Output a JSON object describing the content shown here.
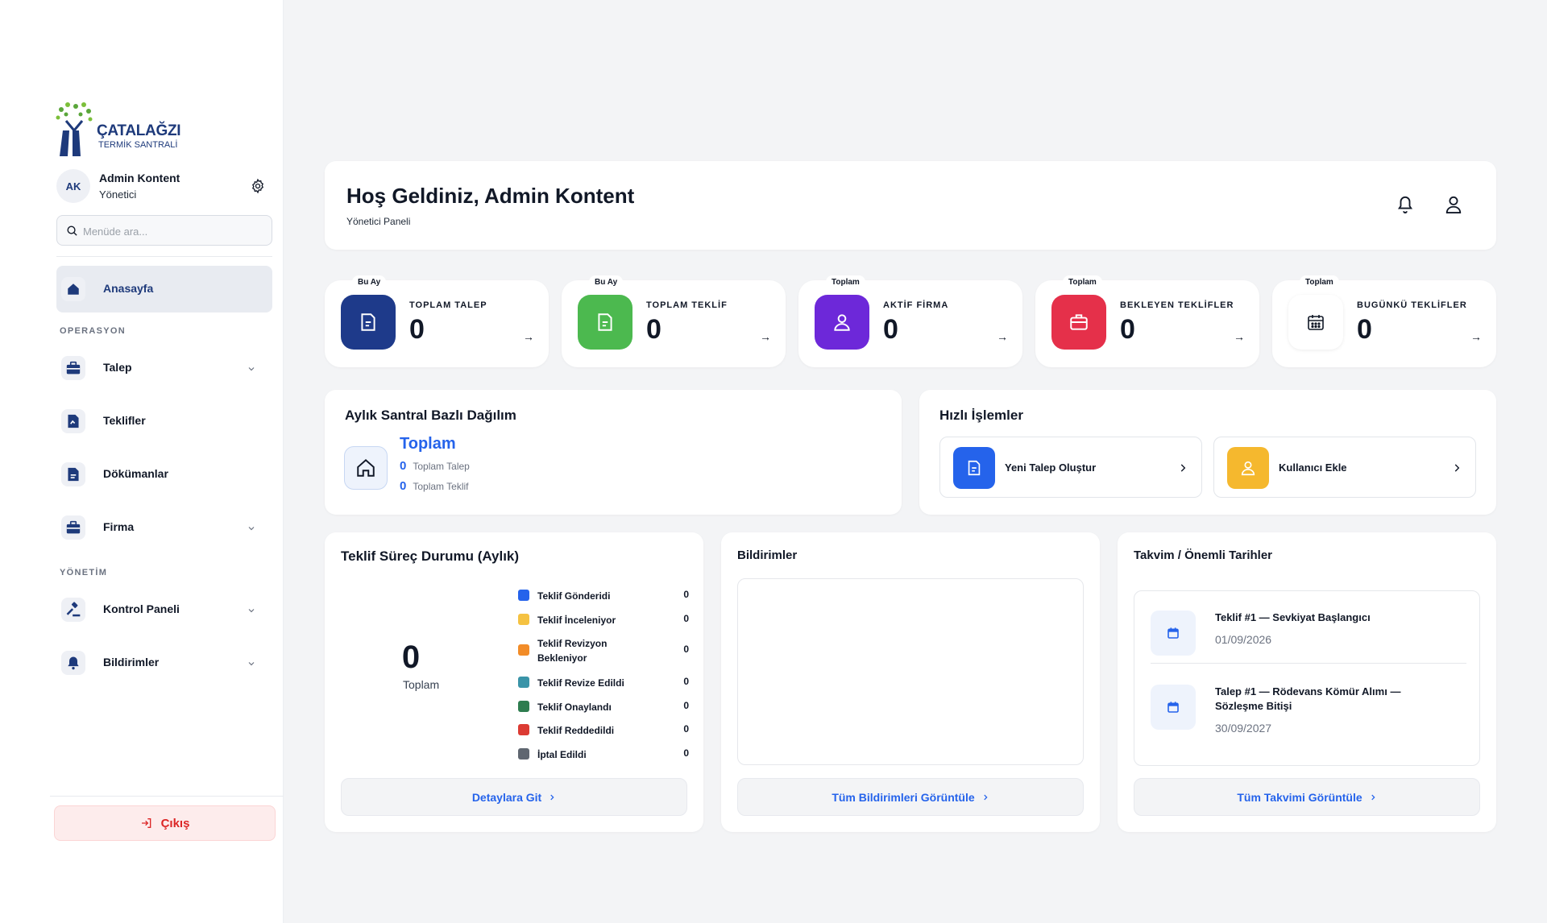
{
  "sidebar": {
    "logo_brand": "ÇATALAĞZI",
    "logo_sub": "TERMİK SANTRALİ",
    "avatar_initials": "AK",
    "user_name": "Admin Kontent",
    "user_role": "Yönetici",
    "search_placeholder": "Menüde ara...",
    "home_label": "Anasayfa",
    "section_ops": "OPERASYON",
    "section_mgmt": "YÖNETİM",
    "items": [
      {
        "label": "Talep",
        "icon": "briefcase-icon",
        "has_chevron": true
      },
      {
        "label": "Teklifler",
        "icon": "document-icon",
        "has_chevron": false
      },
      {
        "label": "Dökümanlar",
        "icon": "document-icon",
        "has_chevron": false
      },
      {
        "label": "Firma",
        "icon": "briefcase-icon",
        "has_chevron": true
      },
      {
        "label": "Kontrol Paneli",
        "icon": "gavel-icon",
        "has_chevron": true
      },
      {
        "label": "Bildirimler",
        "icon": "bell-icon",
        "has_chevron": true
      }
    ],
    "logout_label": "Çıkış"
  },
  "header": {
    "title": "Hoş Geldiniz, Admin Kontent",
    "subtitle": "Yönetici Paneli"
  },
  "stats": [
    {
      "badge": "Bu Ay",
      "title": "TOPLAM TALEP",
      "value": "0",
      "color": "#1e3a8a",
      "icon": "document-icon"
    },
    {
      "badge": "Bu Ay",
      "title": "TOPLAM TEKLİF",
      "value": "0",
      "color": "#4cb94f",
      "icon": "document-icon"
    },
    {
      "badge": "Toplam",
      "title": "AKTİF FİRMA",
      "value": "0",
      "color": "#6d28d9",
      "icon": "user-icon"
    },
    {
      "badge": "Toplam",
      "title": "BEKLEYEN TEKLİFLER",
      "value": "0",
      "color": "#e5304a",
      "icon": "briefcase-icon"
    },
    {
      "badge": "Toplam",
      "title": "BUGÜNKÜ TEKLİFLER",
      "value": "0",
      "color": "#ffffff",
      "icon": "calendar-icon"
    }
  ],
  "distribution": {
    "title": "Aylık Santral Bazlı Dağılım",
    "total_label": "Toplam",
    "talep_value": "0",
    "talep_label": "Toplam Talep",
    "teklif_value": "0",
    "teklif_label": "Toplam Teklif"
  },
  "quick": {
    "title": "Hızlı İşlemler",
    "actions": [
      {
        "label": "Yeni Talep Oluştur",
        "color": "#2563eb"
      },
      {
        "label": "Kullanıcı Ekle",
        "color": "#f5b82e"
      }
    ]
  },
  "process": {
    "title": "Teklif Süreç Durumu (Aylık)",
    "total_value": "0",
    "total_label": "Toplam",
    "legend": [
      {
        "label": "Teklif Gönderidi",
        "value": "0",
        "color": "#2563eb"
      },
      {
        "label": "Teklif İnceleniyor",
        "value": "0",
        "color": "#f5c242"
      },
      {
        "label": "Teklif Revizyon Bekleniyor",
        "value": "0",
        "color": "#f28c28"
      },
      {
        "label": "Teklif Revize Edildi",
        "value": "0",
        "color": "#3a94a8"
      },
      {
        "label": "Teklif Onaylandı",
        "value": "0",
        "color": "#2e7d4f"
      },
      {
        "label": "Teklif Reddedildi",
        "value": "0",
        "color": "#dc3b33"
      },
      {
        "label": "İptal Edildi",
        "value": "0",
        "color": "#5f6670"
      }
    ],
    "button": "Detaylara Git"
  },
  "notifications": {
    "title": "Bildirimler",
    "button": "Tüm Bildirimleri Görüntüle"
  },
  "calendar": {
    "title": "Takvim / Önemli Tarihler",
    "items": [
      {
        "title": "Teklif #1 — Sevkiyat Başlangıcı",
        "date": "01/09/2026"
      },
      {
        "title": "Talep #1 — Rödevans Kömür Alımı — Sözleşme Bitişi",
        "date": "30/09/2027"
      }
    ],
    "button": "Tüm Takvimi Görüntüle"
  }
}
